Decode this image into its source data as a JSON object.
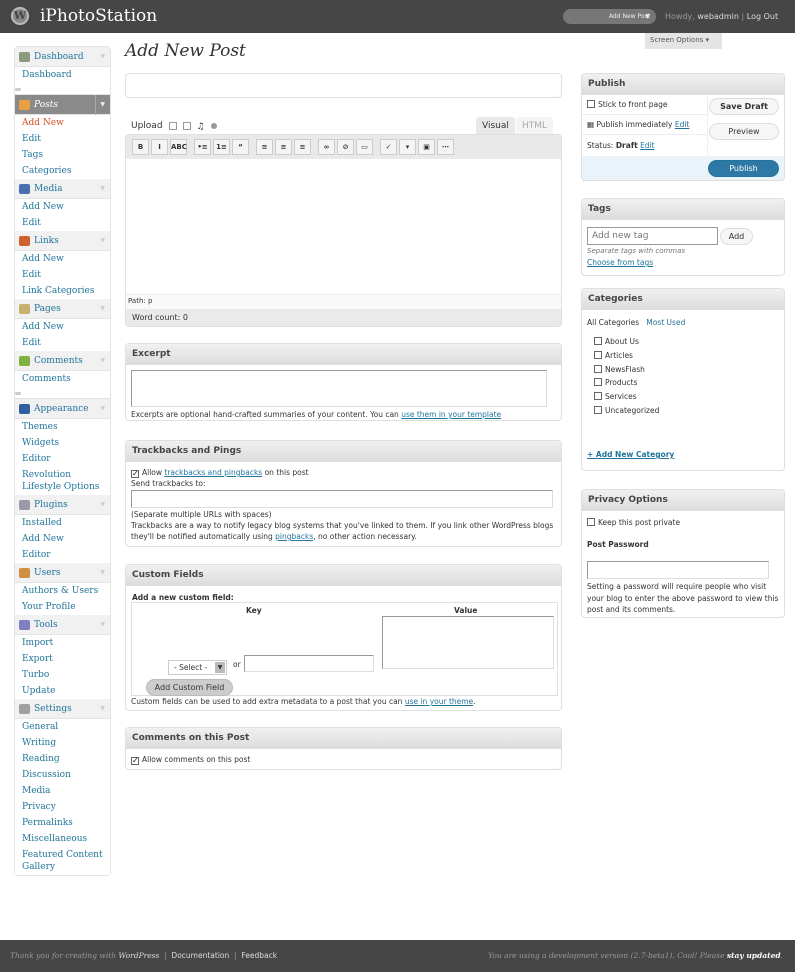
{
  "header": {
    "site_title": "iPhotoStation",
    "favorite_action": "Add New Post",
    "howdy": "Howdy,",
    "user": "webadmin",
    "logout": "Log Out",
    "screen_options": "Screen Options"
  },
  "menu": [
    {
      "label": "Dashboard",
      "icon": "house-icon",
      "color": "#8a9a7a",
      "subs": [
        "Dashboard"
      ]
    },
    {
      "sep": true
    },
    {
      "label": "Posts",
      "icon": "posts-icon",
      "color": "#e8a040",
      "active": true,
      "subs": [
        "Add New",
        "Edit",
        "Tags",
        "Categories"
      ],
      "current": 0
    },
    {
      "label": "Media",
      "icon": "media-icon",
      "color": "#4a70b0",
      "subs": [
        "Add New",
        "Edit"
      ]
    },
    {
      "label": "Links",
      "icon": "links-icon",
      "color": "#d06030",
      "subs": [
        "Add New",
        "Edit",
        "Link Categories"
      ]
    },
    {
      "label": "Pages",
      "icon": "pages-icon",
      "color": "#c8b070",
      "subs": [
        "Add New",
        "Edit"
      ]
    },
    {
      "label": "Comments",
      "icon": "comments-icon",
      "color": "#80b040",
      "subs": [
        "Comments"
      ]
    },
    {
      "sep": true
    },
    {
      "label": "Appearance",
      "icon": "appearance-icon",
      "color": "#3060a0",
      "subs": [
        "Themes",
        "Widgets",
        "Editor",
        "Revolution Lifestyle Options"
      ]
    },
    {
      "label": "Plugins",
      "icon": "plugins-icon",
      "color": "#9999aa",
      "subs": [
        "Installed",
        "Add New",
        "Editor"
      ]
    },
    {
      "label": "Users",
      "icon": "users-icon",
      "color": "#d09040",
      "subs": [
        "Authors & Users",
        "Your Profile"
      ]
    },
    {
      "label": "Tools",
      "icon": "tools-icon",
      "color": "#8080c0",
      "subs": [
        "Import",
        "Export",
        "Turbo",
        "Update"
      ]
    },
    {
      "label": "Settings",
      "icon": "settings-icon",
      "color": "#a0a0a0",
      "subs": [
        "General",
        "Writing",
        "Reading",
        "Discussion",
        "Media",
        "Privacy",
        "Permalinks",
        "Miscellaneous",
        "Featured Content Gallery"
      ]
    }
  ],
  "page_title": "Add New Post",
  "editor": {
    "upload": "Upload",
    "tab_visual": "Visual",
    "tab_html": "HTML",
    "toolbar": [
      "B",
      "I",
      "ABC",
      "•≡",
      "1≡",
      "“",
      "≡",
      "≡",
      "≡",
      "∞",
      "⊘",
      "▭",
      "✓",
      "▾",
      "▣",
      "⋯"
    ],
    "path": "Path: p",
    "word_count": "Word count: 0"
  },
  "excerpt": {
    "title": "Excerpt",
    "help": "Excerpts are optional hand-crafted summaries of your content. You can ",
    "link": "use them in your template"
  },
  "trackbacks": {
    "title": "Trackbacks and Pings",
    "allow_pre": "Allow ",
    "allow_link": "trackbacks and pingbacks",
    "allow_post": " on this post",
    "allow_checked": true,
    "send_label": "Send trackbacks to:",
    "sep_note": "(Separate multiple URLs with spaces)",
    "help_pre": "Trackbacks are a way to notify legacy blog systems that you've linked to them. If you link other WordPress blogs they'll be notified automatically using ",
    "help_link": "pingbacks",
    "help_post": ", no other action necessary."
  },
  "custom_fields": {
    "title": "Custom Fields",
    "add_label": "Add a new custom field:",
    "key": "Key",
    "value": "Value",
    "select": "- Select -",
    "or": "or",
    "button": "Add Custom Field",
    "help_pre": "Custom fields can be used to add extra metadata to a post that you can ",
    "help_link": "use in your theme",
    "help_post": "."
  },
  "comments": {
    "title": "Comments on this Post",
    "allow": "Allow comments on this post",
    "checked": true
  },
  "publish": {
    "title": "Publish",
    "sticky": "Stick to front page",
    "immediately": "Publish immediately",
    "edit": "Edit",
    "status_label": "Status:",
    "status": "Draft",
    "save_draft": "Save Draft",
    "preview": "Preview",
    "publish": "Publish"
  },
  "tags": {
    "title": "Tags",
    "placeholder": "Add new tag",
    "add": "Add",
    "hint": "Separate tags with commas",
    "choose": "Choose from tags"
  },
  "categories": {
    "title": "Categories",
    "tab_all": "All Categories",
    "tab_most": "Most Used",
    "items": [
      "About Us",
      "Articles",
      "NewsFlash",
      "Products",
      "Services",
      "Uncategorized"
    ],
    "add_new": "+ Add New Category"
  },
  "privacy": {
    "title": "Privacy Options",
    "private": "Keep this post private",
    "password_label": "Post Password",
    "help": "Setting a password will require people who visit your blog to enter the above password to view this post and its comments."
  },
  "footer": {
    "thanks": "Thank you for creating with ",
    "wp": "WordPress",
    "documentation": "Documentation",
    "feedback": "Feedback",
    "version": "You are using a development version (2.7-beta1). Cool! Please ",
    "stay": "stay updated",
    "end": "."
  }
}
